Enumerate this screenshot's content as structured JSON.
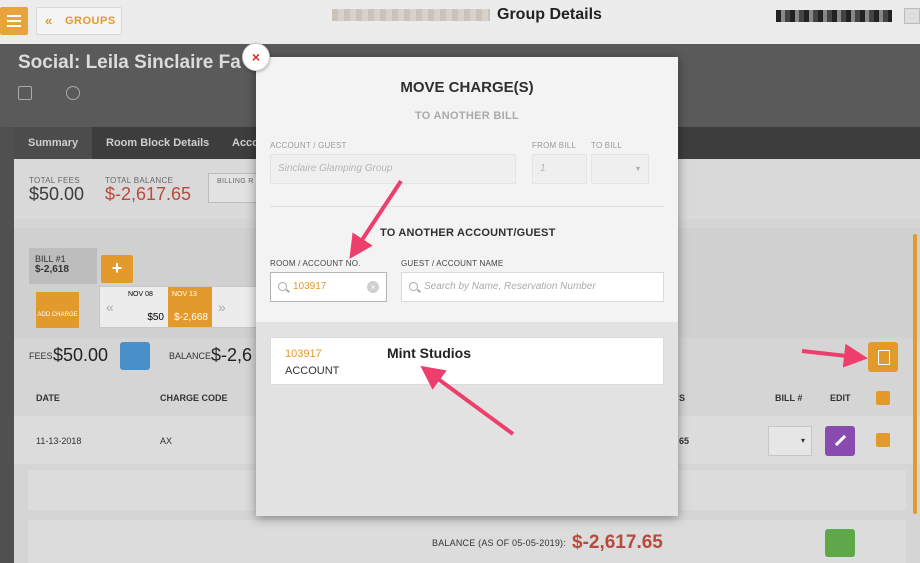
{
  "topbar": {
    "back_label": "GROUPS",
    "title": "Group Details"
  },
  "group": {
    "name": "Social: Leila Sinclaire Fa"
  },
  "tabs": [
    {
      "label": "Summary"
    },
    {
      "label": "Room Block Details"
    },
    {
      "label": "Acco"
    }
  ],
  "totals": {
    "total_fees_label": "TOTAL FEES",
    "total_fees_value": "$50.00",
    "total_balance_label": "TOTAL BALANCE",
    "total_balance_value": "$-2,617.65",
    "billing_label": "BILLING R"
  },
  "bill": {
    "tab_label": "BILL #1",
    "tab_value": "$-2,618",
    "add_label": "+",
    "add_charge_label": "ADD CHARGE",
    "dates": [
      {
        "date": "NOV 08",
        "amount": "$50",
        "selected": false
      },
      {
        "date": "NOV 13",
        "amount": "$-2,668",
        "selected": true
      }
    ],
    "fees_label": "FEES",
    "fees_value": "$50.00",
    "balance_label": "BALANCE",
    "balance_value": "$-2,6"
  },
  "table": {
    "headers": [
      "DATE",
      "CHARGE CODE",
      "S",
      "BILL #",
      "EDIT"
    ],
    "row": {
      "date": "11-13-2018",
      "code": "AX",
      "amount": "65"
    },
    "balance_label": "BALANCE (AS OF 05-05-2019):",
    "balance_value": "$-2,617.65"
  },
  "modal": {
    "close_label": "×",
    "title": "MOVE CHARGE(S)",
    "subtitle": "TO ANOTHER BILL",
    "account_guest_label": "ACCOUNT / GUEST",
    "account_guest_value": "Sinclaire Glamping Group",
    "from_bill_label": "FROM BILL",
    "from_bill_value": "1",
    "to_bill_label": "TO BILL",
    "section2_title": "TO ANOTHER ACCOUNT/GUEST",
    "room_account_label": "ROOM / ACCOUNT NO.",
    "room_account_value": "103917",
    "guest_name_label": "GUEST / ACCOUNT NAME",
    "guest_name_placeholder": "Search by Name, Reservation Number",
    "results": [
      {
        "number": "103917",
        "type": "ACCOUNT",
        "name": "Mint Studios"
      }
    ]
  },
  "colors": {
    "accent": "#e39a2d",
    "negative": "#b84a3a",
    "annotation": "#ee3e6c"
  }
}
